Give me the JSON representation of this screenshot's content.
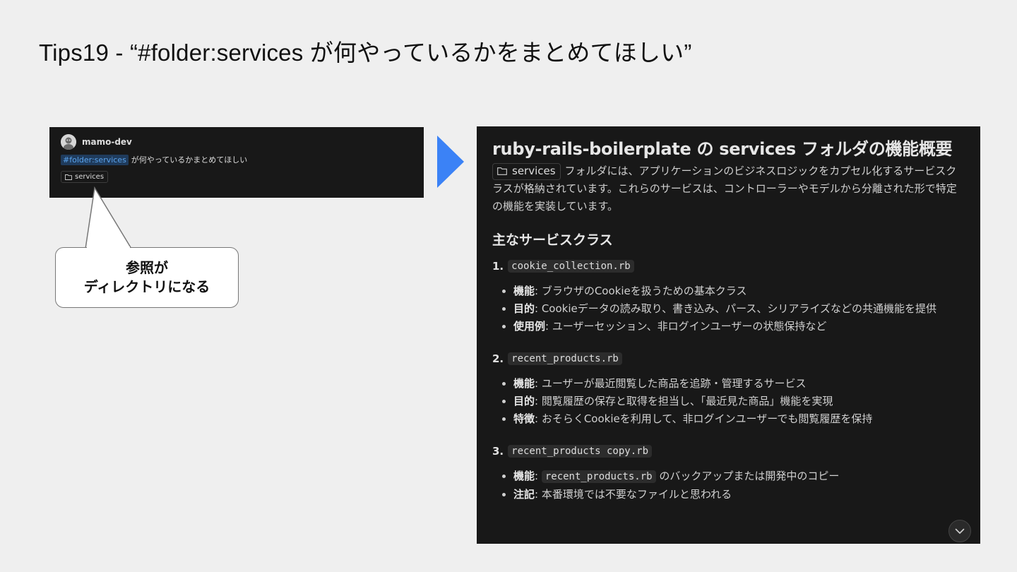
{
  "slide_title": "Tips19 - “#folder:services が何やっているかをまとめてほしい”",
  "chat": {
    "username": "mamo-dev",
    "mention": "#folder:services",
    "message": "が何やっているかまとめてほしい",
    "chip": "services"
  },
  "callout": {
    "line1": "参照が",
    "line2": "ディレクトリになる"
  },
  "doc": {
    "title": "ruby-rails-boilerplate の services フォルダの機能概要",
    "intro_chip": "services",
    "intro": "フォルダには、アプリケーションのビジネスロジックをカプセル化するサービスクラスが格納されています。これらのサービスは、コントローラーやモデルから分離された形で特定の機能を実装しています。",
    "section_title": "主なサービスクラス",
    "services": [
      {
        "num": "1.",
        "file": "cookie_collection.rb",
        "items": [
          {
            "label": "機能",
            "text": ": ブラウザのCookieを扱うための基本クラス"
          },
          {
            "label": "目的",
            "text": ": Cookieデータの読み取り、書き込み、パース、シリアライズなどの共通機能を提供"
          },
          {
            "label": "使用例",
            "text": ": ユーザーセッション、非ログインユーザーの状態保持など"
          }
        ]
      },
      {
        "num": "2.",
        "file": "recent_products.rb",
        "items": [
          {
            "label": "機能",
            "text": ": ユーザーが最近閲覧した商品を追跡・管理するサービス"
          },
          {
            "label": "目的",
            "text": ": 閲覧履歴の保存と取得を担当し、「最近見た商品」機能を実現"
          },
          {
            "label": "特徴",
            "text": ": おそらくCookieを利用して、非ログインユーザーでも閲覧履歴を保持"
          }
        ]
      },
      {
        "num": "3.",
        "file": "recent_products copy.rb",
        "items": [
          {
            "label": "機能",
            "code": "recent_products.rb",
            "text": " のバックアップまたは開発中のコピー"
          },
          {
            "label": "注記",
            "text": ": 本番環境では不要なファイルと思われる"
          }
        ]
      }
    ]
  },
  "colors": {
    "background": "#efefef",
    "panel": "#181818",
    "arrow": "#3b82f6",
    "mention_text": "#5aa3ec"
  }
}
